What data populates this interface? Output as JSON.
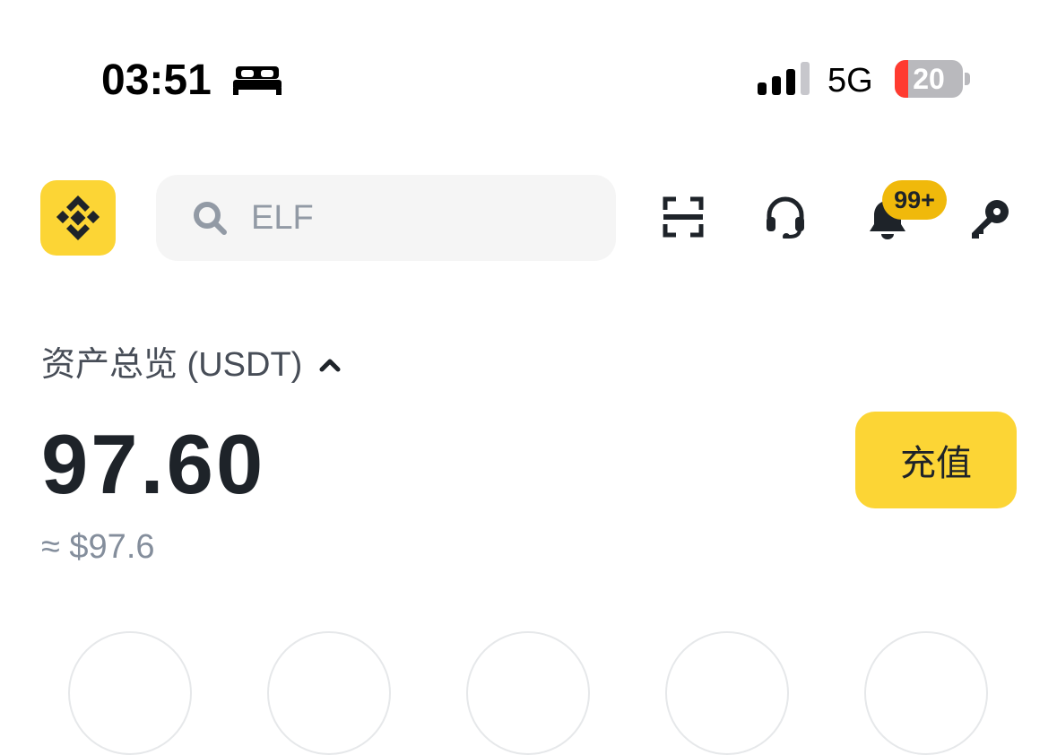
{
  "status_bar": {
    "time": "03:51",
    "network": "5G",
    "battery": "20",
    "battery_level": 0.2
  },
  "header": {
    "logo_icon": "binance-logo-icon",
    "search": {
      "placeholder": "ELF",
      "icon": "search-icon"
    },
    "icons": [
      "scan-icon",
      "headset-icon",
      "bell-icon",
      "key-icon"
    ],
    "notification_badge": "99+"
  },
  "balance": {
    "label": "资产总览 (USDT)",
    "amount": "97.60",
    "fiat": "≈ $97.6",
    "deposit_label": "充值"
  },
  "colors": {
    "brand": "#fcd535",
    "badge": "#f0b90b",
    "text": "#1e2329",
    "muted": "#848e9c"
  }
}
